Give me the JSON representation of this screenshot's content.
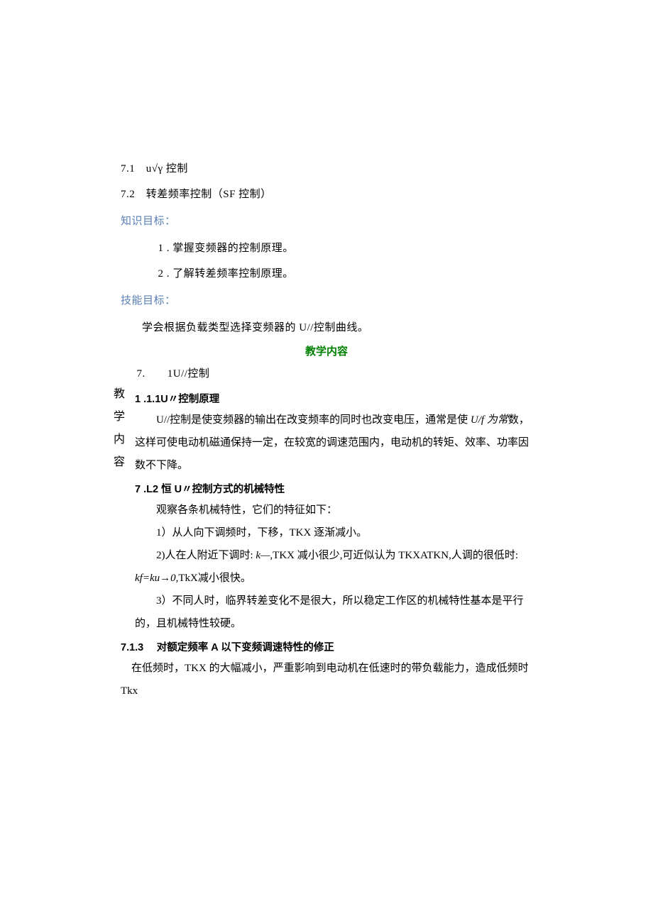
{
  "sideLabel": {
    "c1": "教",
    "c2": "学",
    "c3": "内",
    "c4": "容"
  },
  "top": {
    "l1": "7.1　u√γ 控制",
    "l2": "7.2　转差频率控制（SF 控制）"
  },
  "labels": {
    "knowledge": "知识目标：",
    "skill": "技能目标："
  },
  "knowledge": {
    "k1": "1 . 掌握变频器的控制原理。",
    "k2": "2 . 了解转差频率控制原理。"
  },
  "skill": {
    "s1": "学会根据负载类型选择变频器的 U//控制曲线。"
  },
  "greenTitle": "教学内容",
  "sec7": "7.　　1U//控制",
  "h711": "1 .1.1U〃控制原理",
  "p711": "U//控制是使变频器的输出在改变频率的同时也改变电压，通常是使",
  "p711_it": " U/f 为常",
  "p711_tail": "数，这样可使电动机磁通保持一定，在较宽的调速范围内，电动机的转矩、效率、功率因数不下降。",
  "h712": "7 .L2 恒 U〃控制方式的机械特性",
  "p712a": "观察各条机械特性，它们的特征如下：",
  "p712b": "1）从人向下调频时，下移，TKX 逐渐减小。",
  "p712c_a": "2)人在人附近下调时:",
  "p712c_it1": " k—",
  "p712c_b": ",TKX 减小很少,可近似认为 TKXATKN,人调的很低时:",
  "p712c_it2": " kf=ku→0,",
  "p712c_c": "TkX减小很快。",
  "p712d": "3）不同人时，临界转差变化不是很大，所以稳定工作区的机械特性基本是平行的，且机械特性较硬。",
  "h713": "7.1.3　 对额定频率 A 以下变频调速特性的修正",
  "p713": "在低频时，TKX 的大幅减小，严重影响到电动机在低速时的带负载能力，造成低频时 Tkx"
}
